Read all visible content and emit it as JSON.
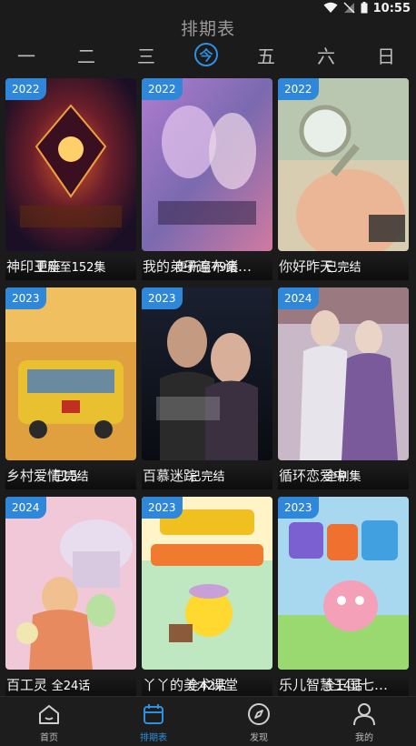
{
  "status_bar": {
    "time": "10:55"
  },
  "header": {
    "title": "排期表"
  },
  "day_tabs": [
    {
      "label": "一",
      "active": false
    },
    {
      "label": "二",
      "active": false
    },
    {
      "label": "三",
      "active": false
    },
    {
      "label": "今",
      "active": true
    },
    {
      "label": "五",
      "active": false
    },
    {
      "label": "六",
      "active": false
    },
    {
      "label": "日",
      "active": false
    }
  ],
  "cards": [
    {
      "year": "2022",
      "status": "更新至152集",
      "title": "神印王座"
    },
    {
      "year": "2022",
      "status": "更新至79集",
      "title": "我的弟子遍布诸…"
    },
    {
      "year": "2022",
      "status": "已完结",
      "title": "你好昨天"
    },
    {
      "year": "2023",
      "status": "已完结",
      "title": "乡村爱情15"
    },
    {
      "year": "2023",
      "status": "已完结",
      "title": "百慕迷踪"
    },
    {
      "year": "2024",
      "status": "全剧集",
      "title": "循环恋爱中"
    },
    {
      "year": "2024",
      "status": "全24话",
      "title": "百工灵"
    },
    {
      "year": "2023",
      "status": "全42话",
      "title": "丫丫的美术课堂"
    },
    {
      "year": "2023",
      "status": "全14话",
      "title": "乐儿智慧王国七…"
    }
  ],
  "bottom_nav": [
    {
      "label": "首页",
      "icon": "home-icon",
      "active": false
    },
    {
      "label": "排期表",
      "icon": "calendar-icon",
      "active": true
    },
    {
      "label": "发现",
      "icon": "compass-icon",
      "active": false
    },
    {
      "label": "我的",
      "icon": "user-icon",
      "active": false
    }
  ],
  "colors": {
    "accent": "#2f8fe0",
    "badge": "#2f87d9",
    "background": "#1b1b1b"
  }
}
